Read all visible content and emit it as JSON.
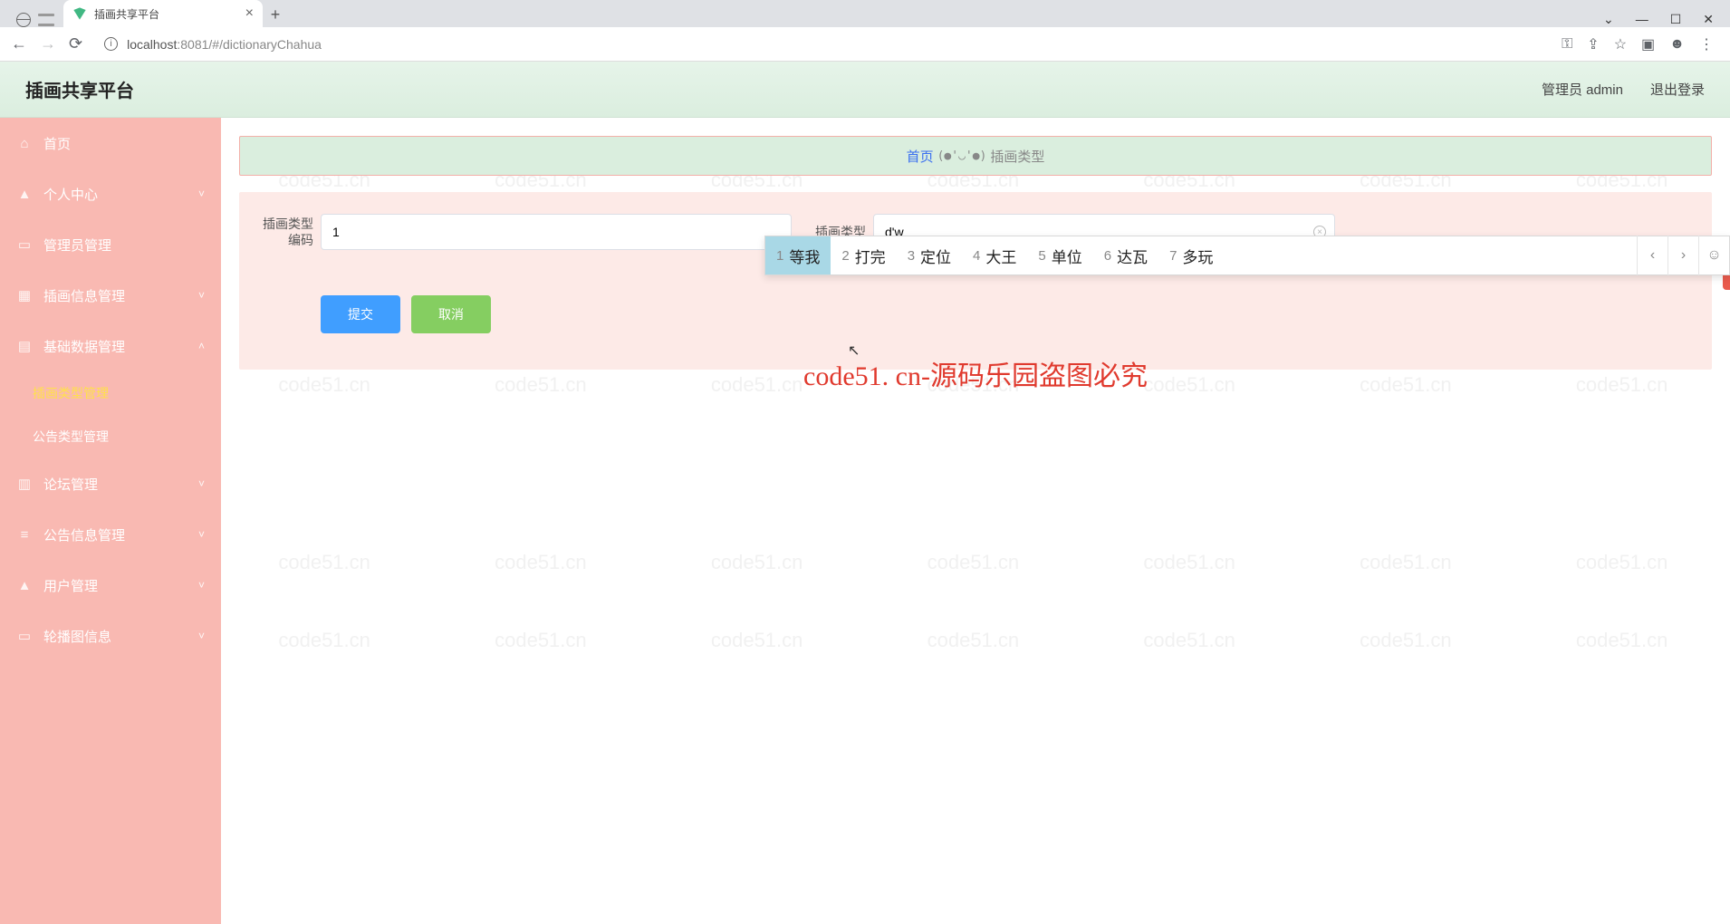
{
  "browser": {
    "tab_title": "插画共享平台",
    "url_host": "localhost",
    "url_port": ":8081",
    "url_path": "/#/dictionaryChahua"
  },
  "header": {
    "app_title": "插画共享平台",
    "user_label": "管理员 admin",
    "logout": "退出登录"
  },
  "sidebar": {
    "items": [
      {
        "icon": "home",
        "label": "首页",
        "expandable": false
      },
      {
        "icon": "user",
        "label": "个人中心",
        "expandable": true,
        "open": false
      },
      {
        "icon": "admin",
        "label": "管理员管理",
        "expandable": false
      },
      {
        "icon": "image",
        "label": "插画信息管理",
        "expandable": true,
        "open": false
      },
      {
        "icon": "db",
        "label": "基础数据管理",
        "expandable": true,
        "open": true
      },
      {
        "icon": "chart",
        "label": "论坛管理",
        "expandable": true,
        "open": false
      },
      {
        "icon": "list",
        "label": "公告信息管理",
        "expandable": true,
        "open": false
      },
      {
        "icon": "user",
        "label": "用户管理",
        "expandable": true,
        "open": false
      },
      {
        "icon": "slide",
        "label": "轮播图信息",
        "expandable": true,
        "open": false
      }
    ],
    "submenu4": [
      {
        "label": "插画类型管理",
        "active": true
      },
      {
        "label": "公告类型管理",
        "active": false
      }
    ]
  },
  "breadcrumb": {
    "home": "首页",
    "sep": "(●'◡'●)",
    "current": "插画类型"
  },
  "form": {
    "label1": "插画类型编码",
    "label1_line1": "插画类型",
    "label1_line2": "编码",
    "value1": "1",
    "label2": "插画类型",
    "value2": "d'w",
    "submit": "提交",
    "cancel": "取消"
  },
  "ime": {
    "candidates": [
      {
        "n": "1",
        "t": "等我"
      },
      {
        "n": "2",
        "t": "打完"
      },
      {
        "n": "3",
        "t": "定位"
      },
      {
        "n": "4",
        "t": "大王"
      },
      {
        "n": "5",
        "t": "单位"
      },
      {
        "n": "6",
        "t": "达瓦"
      },
      {
        "n": "7",
        "t": "多玩"
      }
    ]
  },
  "watermark_small": "code51.cn",
  "watermark_big": "code51. cn-源码乐园盗图必究"
}
